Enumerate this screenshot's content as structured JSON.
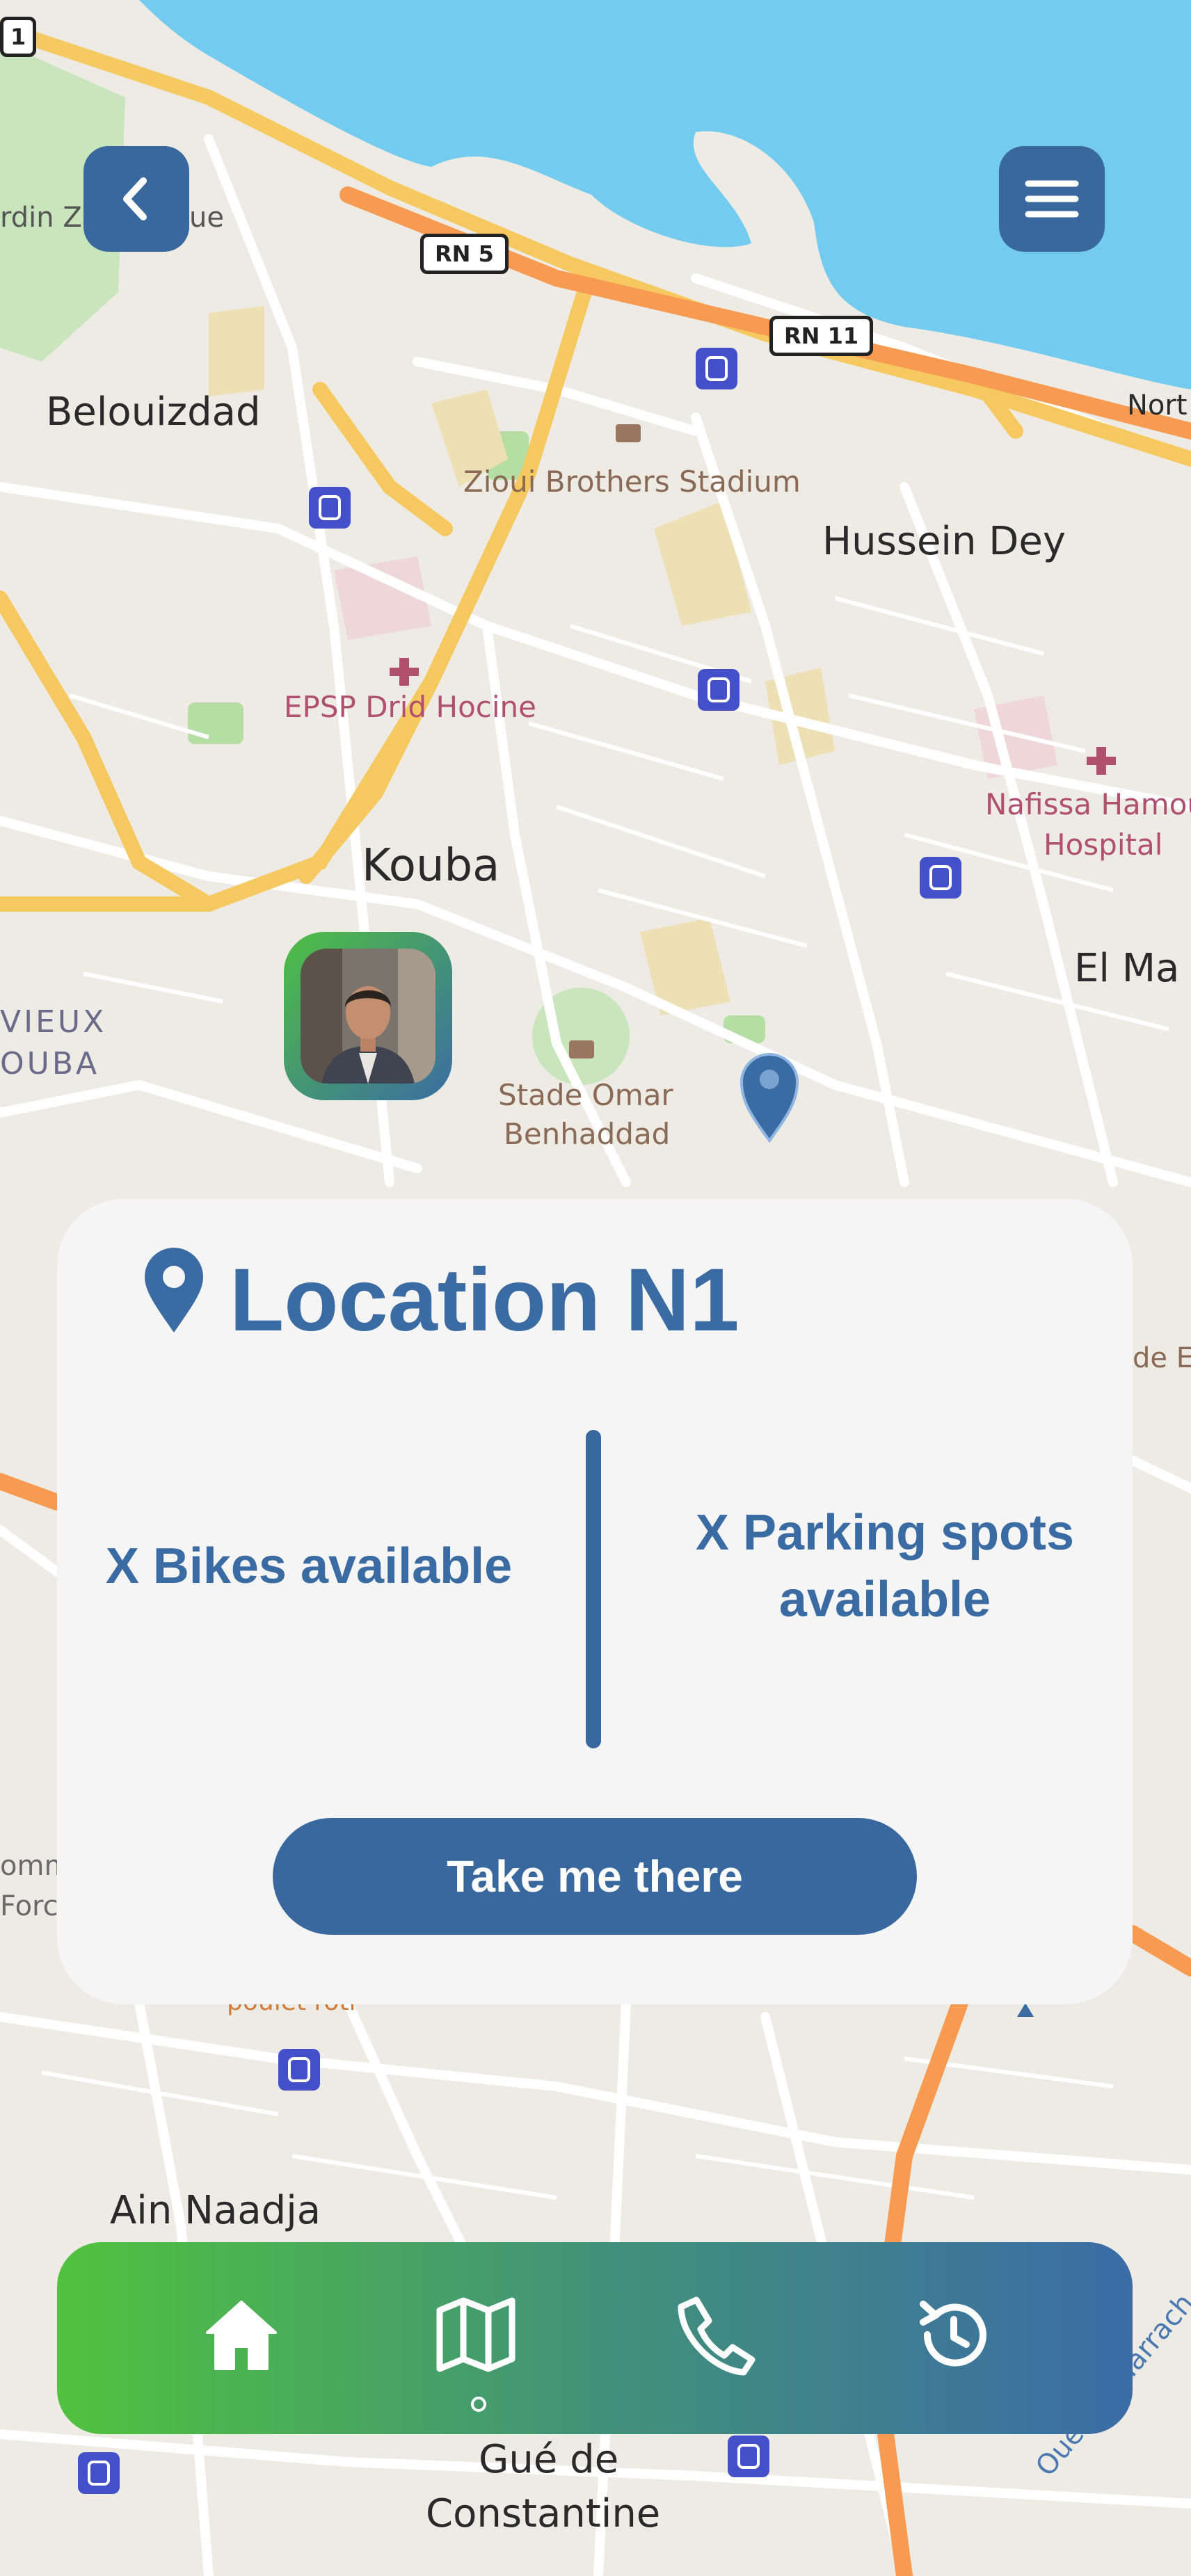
{
  "map": {
    "labels": {
      "belouizdad": "Belouizdad",
      "hussein_dey": "Hussein Dey",
      "kouba": "Kouba",
      "el_ma": "El Ma",
      "ain_naadja": "Ain Naadja",
      "gue_de_constantine_1": "Gué de",
      "gue_de_constantine_2": "Constantine",
      "zioui_stadium": "Zioui Brothers Stadium",
      "epsp": "EPSP Drid Hocine",
      "nafissa_1": "Nafissa Hamou",
      "nafissa_2": "Hospital",
      "stade_omar_1": "Stade Omar",
      "stade_omar_2": "Benhaddad",
      "vieux_1": "VIEUX",
      "vieux_2": "OUBA",
      "jardin": "rdin Z",
      "jardin_end": "ue",
      "nort": "Nort",
      "oued": "Oued El Harrach",
      "est": "de Est",
      "comm_1": "omm",
      "comm_2": "Force",
      "partial": "poulet roti"
    },
    "shields": {
      "rn5": "RN 5",
      "rn11": "RN 11",
      "r1": "1"
    }
  },
  "header": {
    "back_icon": "chevron-left-icon",
    "menu_icon": "hamburger-menu-icon"
  },
  "card": {
    "icon": "location-pin-icon",
    "title": "Location N1",
    "bikes_text": "X Bikes available",
    "parking_text_1": "X Parking spots",
    "parking_text_2": "available",
    "cta_label": "Take me there"
  },
  "nav": {
    "items": [
      {
        "icon": "home-icon",
        "active": true
      },
      {
        "icon": "map-icon",
        "active": false
      },
      {
        "icon": "phone-icon",
        "active": false
      },
      {
        "icon": "history-icon",
        "active": false
      }
    ]
  },
  "colors": {
    "primary": "#39689e",
    "gradient_start": "#50c23e",
    "gradient_end": "#3b6ca6",
    "card_bg": "#f5f5f5",
    "water": "#73ccef"
  }
}
